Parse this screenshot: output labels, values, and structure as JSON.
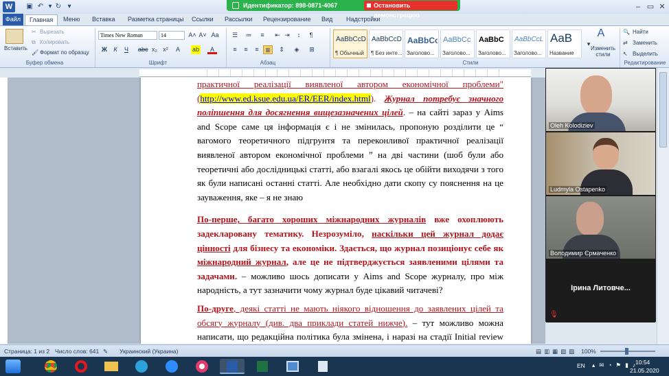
{
  "titlebar": {
    "app_letter": "W",
    "zoom_id_text": "Идентификатор: 898-0871-4067",
    "zoom_stop_label": "Остановить демонстрацию"
  },
  "tabs": {
    "file": "Файл",
    "items": [
      "Главная",
      "Меню",
      "Вставка",
      "Разметка страницы",
      "Ссылки",
      "Рассылки",
      "Рецензирование",
      "Вид",
      "Надстройки"
    ]
  },
  "ribbon": {
    "paste": "Вставить",
    "cut": "Вырезать",
    "copy": "Копировать",
    "format_painter": "Формат по образцу",
    "clipboard_group": "Буфер обмена",
    "font_name": "Times New Roman",
    "font_size": "14",
    "font_group": "Шрифт",
    "paragraph_group": "Абзац",
    "styles": [
      {
        "sample": "AaBbCcDc",
        "name": "¶ Обычный"
      },
      {
        "sample": "AaBbCcDc",
        "name": "¶ Без инте..."
      },
      {
        "sample": "AaBbCc",
        "name": "Заголово..."
      },
      {
        "sample": "AaBbCc",
        "name": "Заголово..."
      },
      {
        "sample": "AaBbC",
        "name": "Заголово..."
      },
      {
        "sample": "AaBbCcL",
        "name": "Заголово..."
      },
      {
        "sample": "AaB",
        "name": "Название"
      }
    ],
    "change_styles": "Изменить стили",
    "styles_group": "Стили",
    "find": "Найти",
    "replace": "Заменить",
    "select": "Выделить",
    "editing_group": "Редактирование"
  },
  "document": {
    "p1_a": "практичної реалізації виявленої автором економічної проблеми\"(",
    "p1_link": "http://www.ed.ksue.edu.ua/ER/EER/index.html",
    "p1_b": "). ",
    "p1_c": "Журнал потребує значного поліпшення для досягнення вищезазначених цілей",
    "p1_d": ". – на сайті зараз у Aims and Scope саме ця інформація є і не змінилась, пропоную розділити це “ вагомого теоретичного підгрунтя та переконливої практичної реалізації виявленої автором економічної проблеми ” на дві частини (шоб були або теоретичні або дослідницькі статті, або взагалі якось це обійти виходячи з того як були написані останні статті. Але необхідно дати скопу су пояснення на це зауваження, яке – я не знаю",
    "p2_a": "По-перше, багато хороших міжнародних журналів",
    "p2_b": " вже охоплюють задекларовану тематику. Незрозуміло, ",
    "p2_c": "наскільки цей журнал додає цінності",
    "p2_d": " для бізнесу та економіки. Здається, що журнал позиціонує себе як ",
    "p2_e": "міжнародний журнал",
    "p2_f": ", але це не підтверджується заявленими цілями та задачами.",
    "p2_g": " – можливо шось дописати у Aims and Scope журналу, про між народність, а тут зазначити чому журнал буде цікавий читачеві?",
    "p3_a": "По-друге",
    "p3_b": ", деякі статті не мають ніякого відношення до заявлених цілей та обсягу журналу (див. два приклади статей нижче).",
    "p3_c": " – тут можливо можна написати, що редакційна політика була змінена, і наразі на стадії Initial review значна увага приділяється оцінюванню відповідності статті профілю журналу? (і можливо переглянути статті за минули два роки - чи все там норм, якщо ні, то трішки почекати, виправити ситуацію і надіслати заявку у скопус пізніше)"
  },
  "zoom": {
    "participants": [
      "Oleh Kolodiziev",
      "Ludmyla Ostapenko",
      "Володимир Єрмаченко",
      "Ірина Литовче..."
    ]
  },
  "statusbar": {
    "page": "Страница: 1 из 2",
    "words": "Число слов: 641",
    "language": "Украинский (Украина)",
    "zoom_level": "100%"
  },
  "taskbar": {
    "language": "EN",
    "time": "10:54",
    "date": "21.05.2020"
  }
}
